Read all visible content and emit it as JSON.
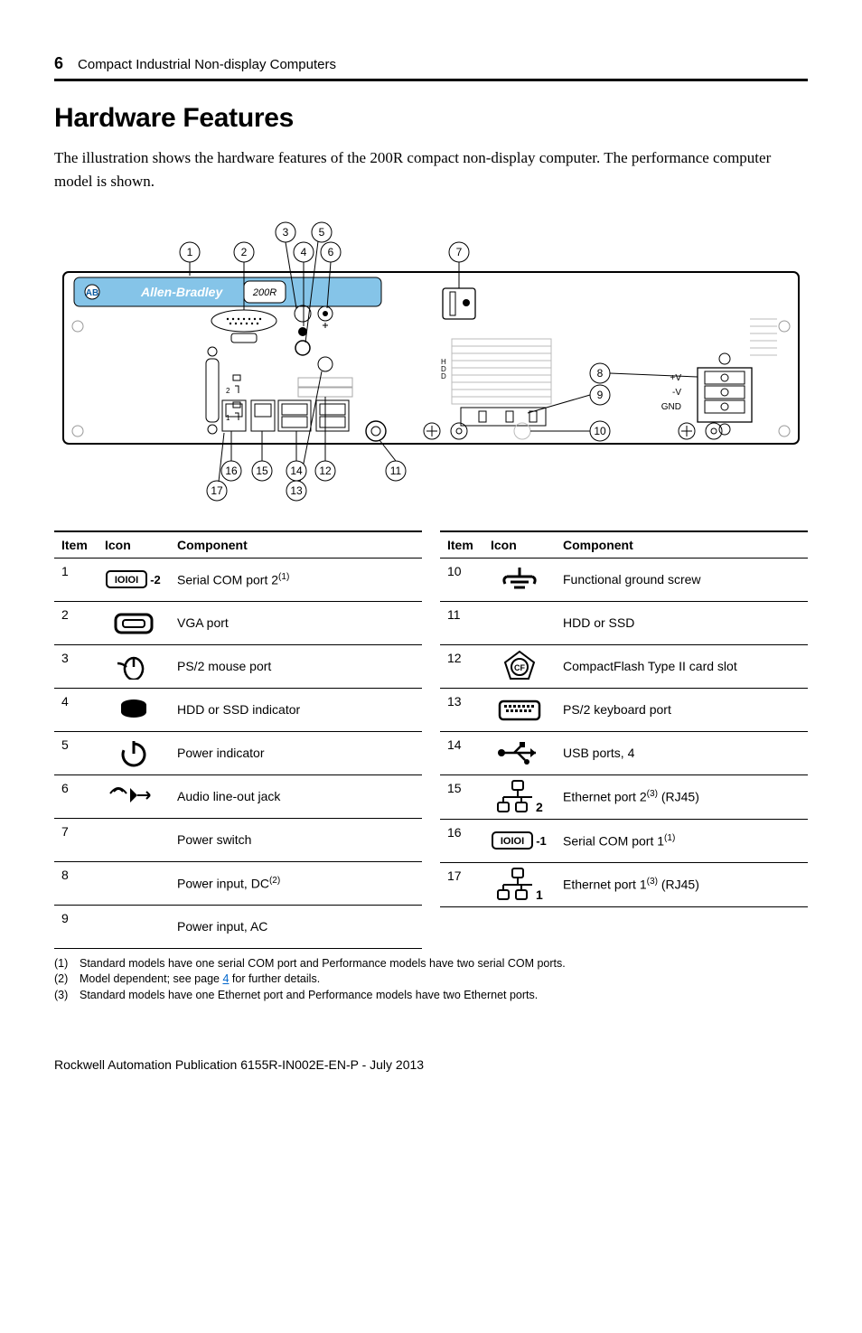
{
  "header": {
    "page_number": "6",
    "doc_title": "Compact Industrial Non-display Computers"
  },
  "section_title": "Hardware Features",
  "intro": "The illustration shows the hardware features of the 200R compact non-display computer. The performance computer model is shown.",
  "figure": {
    "brand_text": "Allen-Bradley",
    "model_label": "200R",
    "hdd_label": "HDD",
    "terminal": {
      "v_pos": "+V",
      "v_neg": "-V",
      "gnd": "GND"
    },
    "callouts_top": [
      "1",
      "2",
      "3",
      "4",
      "5",
      "6",
      "7"
    ],
    "callouts_right": [
      "8",
      "9",
      "10"
    ],
    "callouts_bottom": [
      "11",
      "12",
      "13",
      "14",
      "15",
      "16",
      "17"
    ],
    "port_serial2_label": "2",
    "port_serial1_label": "1",
    "port_eth2_label": "2",
    "port_eth1_label": "1"
  },
  "table_headers": {
    "item": "Item",
    "icon": "Icon",
    "component": "Component"
  },
  "left_table": [
    {
      "item": "1",
      "component_html": "Serial COM port 2<sup>(1)</sup>",
      "icon": "serial2"
    },
    {
      "item": "2",
      "component_html": "VGA port",
      "icon": "vga"
    },
    {
      "item": "3",
      "component_html": "PS/2 mouse port",
      "icon": "ps2mouse"
    },
    {
      "item": "4",
      "component_html": "HDD or SSD indicator",
      "icon": "hddled"
    },
    {
      "item": "5",
      "component_html": "Power indicator",
      "icon": "powerled"
    },
    {
      "item": "6",
      "component_html": "Audio line-out jack",
      "icon": "audio"
    },
    {
      "item": "7",
      "component_html": "Power switch",
      "icon": ""
    },
    {
      "item": "8",
      "component_html": "Power input, DC<sup>(2)</sup>",
      "icon": ""
    },
    {
      "item": "9",
      "component_html": "Power input, AC",
      "icon": ""
    }
  ],
  "right_table": [
    {
      "item": "10",
      "component_html": "Functional ground screw",
      "icon": "ground"
    },
    {
      "item": "11",
      "component_html": "HDD or SSD",
      "icon": ""
    },
    {
      "item": "12",
      "component_html": "CompactFlash Type II card slot",
      "icon": "cf"
    },
    {
      "item": "13",
      "component_html": "PS/2 keyboard port",
      "icon": "keyboard"
    },
    {
      "item": "14",
      "component_html": "USB ports, 4",
      "icon": "usb"
    },
    {
      "item": "15",
      "component_html": "Ethernet port 2<sup>(3)</sup> (RJ45)",
      "icon": "eth2"
    },
    {
      "item": "16",
      "component_html": "Serial COM port 1<sup>(1)</sup>",
      "icon": "serial1"
    },
    {
      "item": "17",
      "component_html": "Ethernet port 1<sup>(3)</sup> (RJ45)",
      "icon": "eth1"
    }
  ],
  "icon_labels": {
    "serial_prefix": "IOIOI",
    "serial2_suffix": "-2",
    "serial1_suffix": "-1",
    "eth2_suffix": "2",
    "eth1_suffix": "1",
    "cf_text": "CF"
  },
  "footnotes": [
    {
      "idx": "(1)",
      "text_html": "Standard models have one serial COM port and Performance models have two serial COM ports."
    },
    {
      "idx": "(2)",
      "text_html": "Model dependent; see page <span class=\"link\">4</span> for further details."
    },
    {
      "idx": "(3)",
      "text_html": "Standard models have one Ethernet port and Performance models have two Ethernet ports."
    }
  ],
  "footer": "Rockwell Automation Publication 6155R-IN002E-EN-P - July 2013"
}
